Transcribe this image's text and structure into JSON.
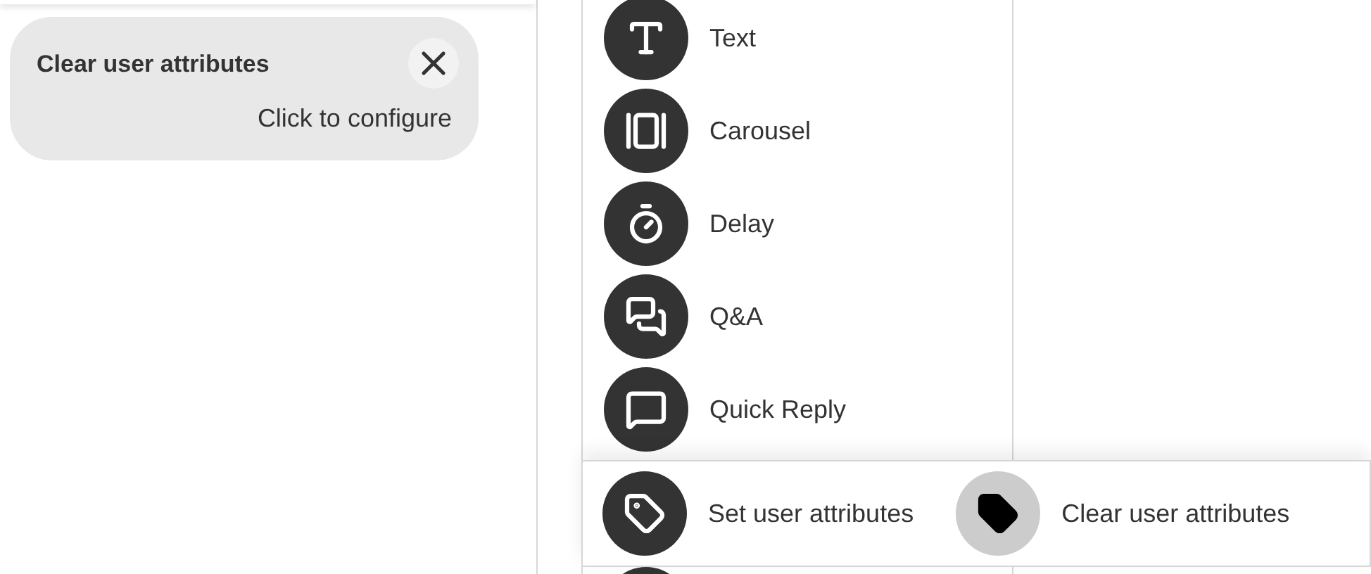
{
  "config_card": {
    "title": "Clear user attributes",
    "action": "Click to configure"
  },
  "palette": [
    {
      "kind": "text",
      "label": "Text"
    },
    {
      "kind": "carousel",
      "label": "Carousel"
    },
    {
      "kind": "delay",
      "label": "Delay"
    },
    {
      "kind": "qa",
      "label": "Q&A"
    },
    {
      "kind": "quick_reply",
      "label": "Quick Reply"
    }
  ],
  "attribute_options": [
    {
      "label": "Set user attributes",
      "selected": false
    },
    {
      "label": "Clear user attributes",
      "selected": true
    }
  ]
}
